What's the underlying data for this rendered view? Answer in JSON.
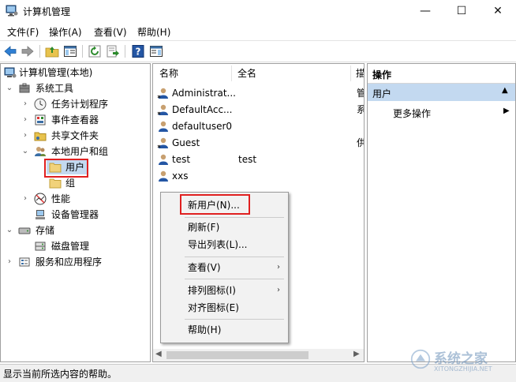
{
  "window": {
    "title": "计算机管理",
    "minimize": "—",
    "maximize": "☐",
    "close": "✕"
  },
  "menubar": [
    "文件(F)",
    "操作(A)",
    "查看(V)",
    "帮助(H)"
  ],
  "tree": {
    "root": "计算机管理(本地)",
    "system_tools": "系统工具",
    "task_scheduler": "任务计划程序",
    "event_viewer": "事件查看器",
    "shared_folders": "共享文件夹",
    "local_users_groups": "本地用户和组",
    "users": "用户",
    "groups": "组",
    "performance": "性能",
    "device_manager": "设备管理器",
    "storage": "存储",
    "disk_management": "磁盘管理",
    "services_apps": "服务和应用程序"
  },
  "list": {
    "columns": [
      "名称",
      "全名",
      "描"
    ],
    "rows": [
      {
        "name": "Administrat...",
        "fullname": "",
        "desc": "管"
      },
      {
        "name": "DefaultAcc...",
        "fullname": "",
        "desc": "系"
      },
      {
        "name": "defaultuser0",
        "fullname": "",
        "desc": ""
      },
      {
        "name": "Guest",
        "fullname": "",
        "desc": "供"
      },
      {
        "name": "test",
        "fullname": "test",
        "desc": ""
      },
      {
        "name": "xxs",
        "fullname": "",
        "desc": ""
      }
    ]
  },
  "context_menu": {
    "new_user": "新用户(N)...",
    "refresh": "刷新(F)",
    "export_list": "导出列表(L)...",
    "view": "查看(V)",
    "arrange_icons": "排列图标(I)",
    "line_up_icons": "对齐图标(E)",
    "help": "帮助(H)"
  },
  "actions": {
    "header": "操作",
    "section": "用户",
    "more": "更多操作"
  },
  "status": "显示当前所选内容的帮助。",
  "watermark": {
    "main": "系统之家",
    "sub": "XITONGZHIJIA.NET"
  },
  "colors": {
    "accent_blue": "#c3d9f0",
    "highlight_red": "#e02020",
    "action_header": "#e1e1e1"
  }
}
